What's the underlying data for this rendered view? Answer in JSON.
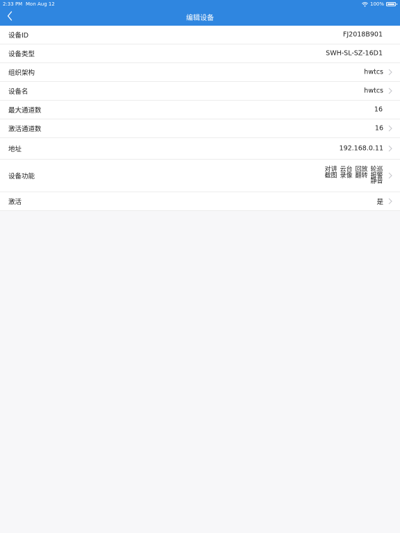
{
  "status_bar": {
    "time": "2:33 PM",
    "date": "Mon Aug 12",
    "battery": "100%"
  },
  "nav": {
    "title": "编辑设备",
    "back_icon": "chevron-left-icon"
  },
  "rows": {
    "device_id": {
      "label": "设备ID",
      "value": "FJ2018B901"
    },
    "device_type": {
      "label": "设备类型",
      "value": "SWH-SL-SZ-16D1"
    },
    "organization": {
      "label": "组织架构",
      "value": "hwtcs"
    },
    "device_name": {
      "label": "设备名",
      "value": "hwtcs"
    },
    "max_channels": {
      "label": "最大通道数",
      "value": "16"
    },
    "active_channels": {
      "label": "激活通道数",
      "value": "16"
    },
    "address": {
      "label": "地址",
      "value": "192.168.0.11"
    },
    "functions": {
      "label": "设备功能",
      "columns": [
        [
          "对讲",
          "截图"
        ],
        [
          "云台",
          "录像"
        ],
        [
          "回放",
          "翻转"
        ],
        [
          "轮巡",
          "报警",
          "静音"
        ]
      ]
    },
    "activate": {
      "label": "激活",
      "value": "是"
    }
  },
  "colors": {
    "header_blue": "#2f86e0",
    "background": "#f7f7f9",
    "row_background": "#ffffff",
    "divider": "#ececec",
    "chevron": "#c7c7cc"
  }
}
